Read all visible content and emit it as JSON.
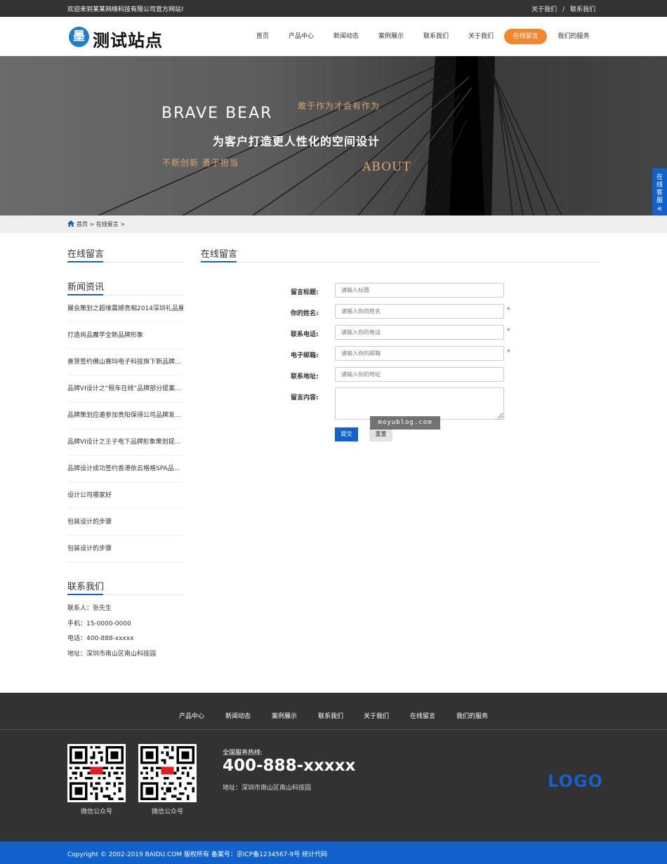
{
  "topbar": {
    "welcome": "欢迎来到某某网络科技有限公司官方网站!",
    "links": [
      "关于我们",
      "联系我们"
    ],
    "separator": "/"
  },
  "header": {
    "logo_char": "墨",
    "site_name": "测试站点",
    "nav": [
      {
        "label": "首页",
        "active": false
      },
      {
        "label": "产品中心",
        "active": false
      },
      {
        "label": "新闻动态",
        "active": false
      },
      {
        "label": "案例展示",
        "active": false
      },
      {
        "label": "联系我们",
        "active": false
      },
      {
        "label": "关于我们",
        "active": false
      },
      {
        "label": "在线留言",
        "active": true
      },
      {
        "label": "我们的服务",
        "active": false
      }
    ]
  },
  "banner": {
    "english": "BRAVE BEAR",
    "slogan_top": "敢于作为才会有作为",
    "main_line": "为客户打造更人性化的空间设计",
    "slogan_bottom": "不断创新  勇于担当",
    "about": "ABOUT"
  },
  "float_service": {
    "label_chars": [
      "在",
      "线",
      "客",
      "服"
    ],
    "arrow": "«"
  },
  "breadcrumb": {
    "home": "首页",
    "sep": ">",
    "current": "在线留言",
    "trail": ">"
  },
  "sidebar": {
    "section_title": "在线留言",
    "news_title": "新闻资讯",
    "news": [
      "展会策划之超维震撼亮相2014深圳礼品展",
      "打造尚品魔芋全新品牌形象",
      "喜贺签约佛山赛玛电子科技旗下新品牌...",
      "品牌VI设计之“租车在线”品牌部分提案...",
      "品牌策划应邀参加贵阳保得公司品牌发...",
      "品牌VI设计之王子电下品牌形象策划提...",
      "品牌设计成功签约香港依云格格SPA品...",
      "设计公司哪家好",
      "包装设计的步骤",
      "包装设计的步骤"
    ],
    "contact_title": "联系我们",
    "contact": [
      "联系人：张先生",
      "手机：15-0000-0000",
      "电话：400-888-xxxxx",
      "地址：深圳市南山区南山科技园"
    ]
  },
  "main": {
    "title": "在线留言",
    "form": {
      "fields": [
        {
          "label": "留言标题:",
          "placeholder": "请输入标题",
          "required": false
        },
        {
          "label": "你的姓名:",
          "placeholder": "请输入你的姓名",
          "required": true
        },
        {
          "label": "联系电话:",
          "placeholder": "请输入你的电话",
          "required": true
        },
        {
          "label": "电子邮箱:",
          "placeholder": "请输入你的邮箱",
          "required": true
        },
        {
          "label": "联系地址:",
          "placeholder": "请输入你的地址",
          "required": false
        }
      ],
      "content_label": "留言内容:",
      "required_mark": "*",
      "submit": "提交",
      "reset": "重置"
    },
    "watermark": "moyublog.com"
  },
  "footer": {
    "nav": [
      "产品中心",
      "新闻动态",
      "案例展示",
      "联系我们",
      "关于我们",
      "在线留言",
      "我们的服务"
    ],
    "qr_caption_1": "微信公众号",
    "qr_caption_2": "微信公众号",
    "qr_badge": "头条",
    "hotline_label": "全国服务热线:",
    "hotline": "400-888-xxxxx",
    "address": "地址：深圳市南山区南山科技园",
    "logo": "LOGO",
    "copyright": "Copyright © 2002-2019 BAIDU.COM 版权所有 备案号：京ICP备1234567-9号  统计代码"
  },
  "colors": {
    "brand_blue": "#1162cc",
    "accent_orange": "#f5862b",
    "banner_gold": "#d9a56b",
    "footer_bg": "#323232",
    "topbar_bg": "#333333"
  }
}
